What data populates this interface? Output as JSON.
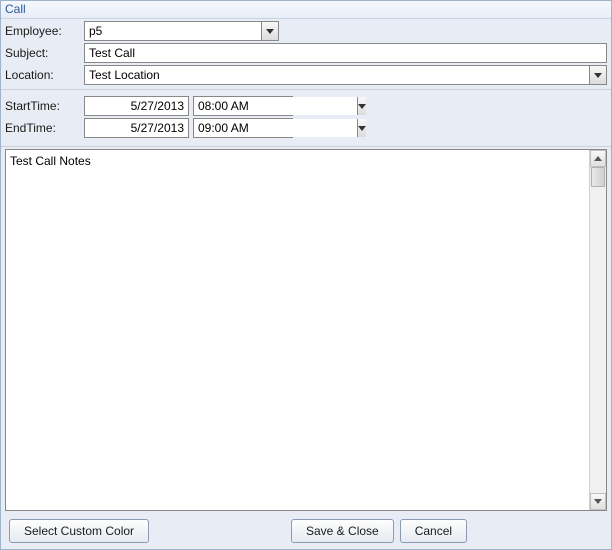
{
  "window": {
    "title": "Call"
  },
  "form": {
    "employee_label": "Employee:",
    "employee_value": "p5",
    "subject_label": "Subject:",
    "subject_value": "Test Call",
    "location_label": "Location:",
    "location_value": "Test Location"
  },
  "time": {
    "start_label": "StartTime:",
    "start_date": "5/27/2013",
    "start_time": "08:00 AM",
    "end_label": "EndTime:",
    "end_date": "5/27/2013",
    "end_time": "09:00 AM"
  },
  "notes": {
    "value": "Test Call Notes"
  },
  "buttons": {
    "select_color": "Select Custom Color",
    "save_close": "Save & Close",
    "cancel": "Cancel"
  }
}
